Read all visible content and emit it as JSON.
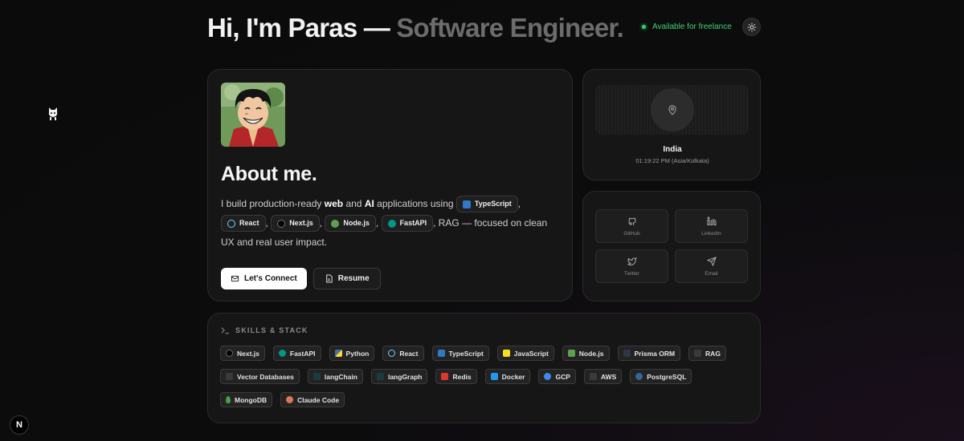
{
  "header": {
    "headline_main": "Hi, I'm Paras —",
    "headline_role": "Software Engineer.",
    "status_text": "Available for freelance",
    "theme_icon": "sun-icon"
  },
  "about": {
    "title": "About me.",
    "text_1": "I build production-ready",
    "web": "web",
    "and": "and",
    "ai": "AI",
    "text_2": "applications using",
    "chips": [
      {
        "label": "TypeScript",
        "color": "#3178c6"
      },
      {
        "label": "React",
        "color": "#61dafb"
      },
      {
        "label": "Next.js",
        "color": "#000000"
      },
      {
        "label": "Node.js",
        "color": "#5fa04e"
      },
      {
        "label": "FastAPI",
        "color": "#009688"
      }
    ],
    "text_3": ", RAG — focused on clean UX and real user impact.",
    "connect_label": "Let's Connect",
    "resume_label": "Resume"
  },
  "location": {
    "country": "India",
    "time": "01:19:22 PM (Asia/Kolkata)"
  },
  "socials": [
    {
      "label": "GitHub",
      "icon": "github-icon"
    },
    {
      "label": "LinkedIn",
      "icon": "linkedin-icon"
    },
    {
      "label": "Twitter",
      "icon": "twitter-icon"
    },
    {
      "label": "Email",
      "icon": "send-icon"
    }
  ],
  "skills": {
    "heading": "SKILLS & STACK",
    "items": [
      {
        "label": "Next.js",
        "color": "#111111"
      },
      {
        "label": "FastAPI",
        "color": "#009688"
      },
      {
        "label": "Python",
        "color": "#3776ab"
      },
      {
        "label": "React",
        "color": "#61dafb"
      },
      {
        "label": "TypeScript",
        "color": "#3178c6"
      },
      {
        "label": "JavaScript",
        "color": "#f7df1e"
      },
      {
        "label": "Node.js",
        "color": "#5fa04e"
      },
      {
        "label": "Prisma ORM",
        "color": "#2d3748"
      },
      {
        "label": "RAG",
        "color": "#555555"
      },
      {
        "label": "Vector Databases",
        "color": "#555555"
      },
      {
        "label": "langChain",
        "color": "#1c3c3c"
      },
      {
        "label": "langGraph",
        "color": "#1c3c3c"
      },
      {
        "label": "Redis",
        "color": "#dc382d"
      },
      {
        "label": "Docker",
        "color": "#2496ed"
      },
      {
        "label": "GCP",
        "color": "#4285f4"
      },
      {
        "label": "AWS",
        "color": "#555555"
      },
      {
        "label": "PostgreSQL",
        "color": "#336791"
      },
      {
        "label": "MongoDB",
        "color": "#47a248"
      },
      {
        "label": "Claude Code",
        "color": "#d97757"
      }
    ]
  },
  "side": {
    "next_badge": "N"
  }
}
